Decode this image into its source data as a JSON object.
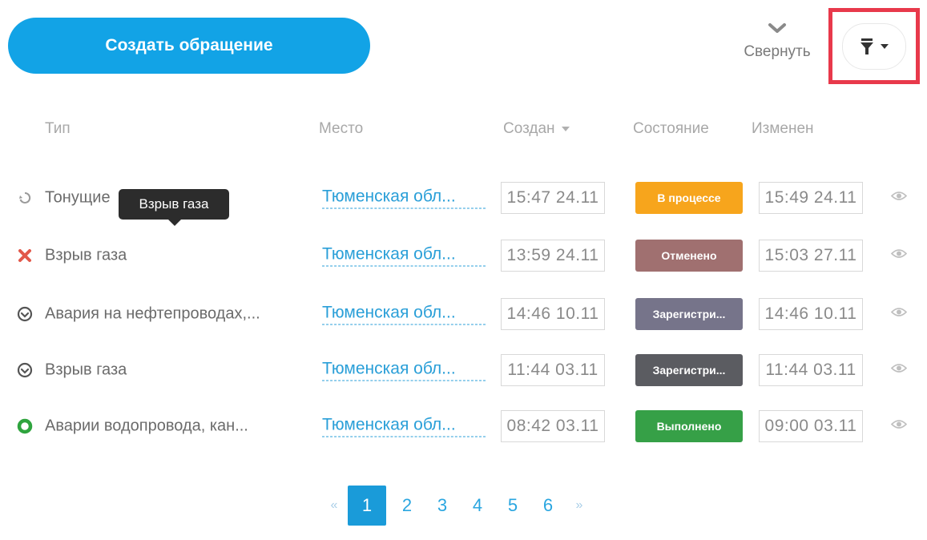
{
  "toolbar": {
    "create_label": "Создать обращение",
    "collapse_label": "Свернуть",
    "filter_icon": "filter-icon",
    "accent_color": "#12a3e6",
    "highlight_color": "#e8394b"
  },
  "columns": {
    "type": "Тип",
    "place": "Место",
    "created": "Создан",
    "state": "Состояние",
    "changed": "Изменен"
  },
  "tooltip": "Взрыв газа",
  "rows": [
    {
      "icon": "spinner-icon",
      "type": "Тонущие",
      "place": "Тюменская обл...",
      "created": "15:47 24.11",
      "state": "В процессе",
      "state_color": "#f7a51c",
      "changed": "15:49 24.11"
    },
    {
      "icon": "cross-icon",
      "type": "Взрыв газа",
      "place": "Тюменская обл...",
      "created": "13:59 24.11",
      "state": "Отменено",
      "state_color": "#a07070",
      "changed": "15:03 27.11"
    },
    {
      "icon": "check-circle-icon",
      "type": "Авария на нефтепроводах,...",
      "place": "Тюменская обл...",
      "created": "14:46 10.11",
      "state": "Зарегистри...",
      "state_color": "#76748a",
      "changed": "14:46 10.11"
    },
    {
      "icon": "check-circle-icon",
      "type": "Взрыв газа",
      "place": "Тюменская обл...",
      "created": "11:44 03.11",
      "state": "Зарегистри...",
      "state_color": "#5b5c61",
      "changed": "11:44 03.11"
    },
    {
      "icon": "green-ring-icon",
      "type": "Аварии водопровода, кан...",
      "place": "Тюменская обл...",
      "created": "08:42 03.11",
      "state": "Выполнено",
      "state_color": "#36a047",
      "changed": "09:00 03.11"
    }
  ],
  "pagination": {
    "prev": "«",
    "next": "»",
    "pages": [
      "1",
      "2",
      "3",
      "4",
      "5",
      "6"
    ],
    "current": "1"
  }
}
